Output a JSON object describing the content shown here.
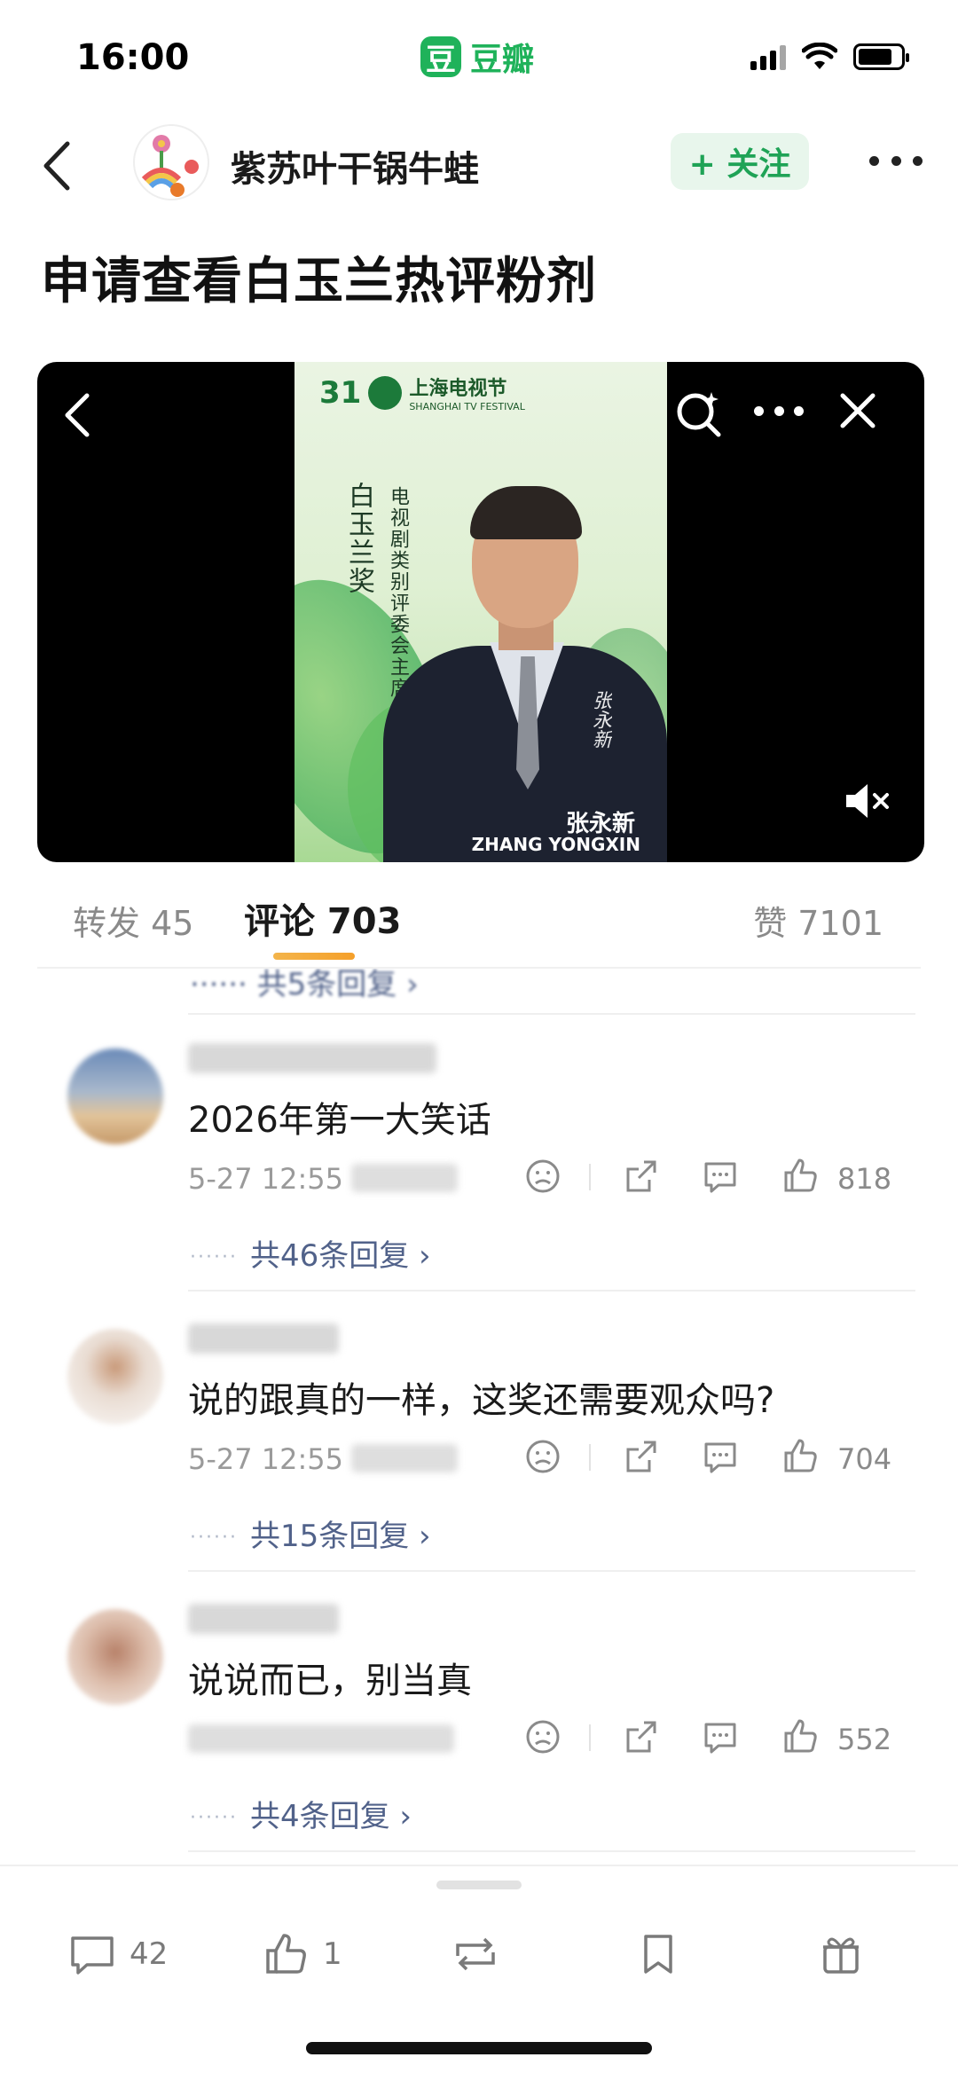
{
  "status_bar": {
    "time": "16:00",
    "app_logo_char": "豆",
    "app_name": "豆瓣"
  },
  "header": {
    "username": "紫苏叶干锅牛蛙",
    "follow_label": "+ 关注"
  },
  "post": {
    "title": "申请查看白玉兰热评粉剂"
  },
  "video": {
    "poster_festival_number": "31",
    "poster_festival_cn": "上海电视节",
    "poster_festival_en": "SHANGHAI TV FESTIVAL",
    "poster_award": "白玉兰奖",
    "poster_role": "电视剧类别评委会主席",
    "poster_name_cn": "张永新",
    "poster_name_en": "ZHANG YONGXIN",
    "poster_signature": "张永新"
  },
  "tabs": {
    "repost": "转发 45",
    "comment": "评论 703",
    "like": "赞 7101"
  },
  "comment_list": {
    "top_reply_label": "······ 共5条回复 ›",
    "comments": [
      {
        "text": "2026年第一大笑话",
        "time": "5-27 12:55",
        "likes": "818",
        "reply_count_label": "共46条回复 ›",
        "reply_dots": "······"
      },
      {
        "text": "说的跟真的一样，这奖还需要观众吗?",
        "time": "5-27 12:55",
        "likes": "704",
        "reply_count_label": "共15条回复 ›",
        "reply_dots": "······"
      },
      {
        "text": "说说而已，别当真",
        "time": "",
        "likes": "552",
        "reply_count_label": "共4条回复 ›",
        "reply_dots": "······"
      }
    ]
  },
  "bottom_bar": {
    "comment_count": "42",
    "like_count": "1"
  },
  "colors": {
    "brand_green": "#1fb25a",
    "link_blue": "#51628a",
    "tab_accent": "#f5a02a"
  }
}
